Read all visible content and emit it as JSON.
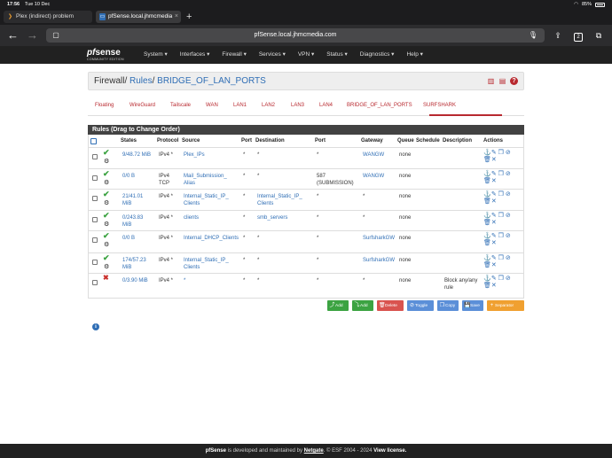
{
  "status_bar": {
    "time": "17:56",
    "date": "Tue 10 Dec",
    "battery": "85%"
  },
  "browser": {
    "tabs": [
      {
        "label": "Plex (indirect) problem"
      },
      {
        "label": "pfSense.local.jhmcmedia"
      }
    ],
    "url": "pfSense.local.jhmcmedia.com",
    "tab_count": "2"
  },
  "pf_nav": {
    "logo": "sense",
    "logo_prefix": "pf",
    "logo_sub": "COMMUNITY EDITION",
    "menu": [
      "System ▾",
      "Interfaces ▾",
      "Firewall ▾",
      "Services ▾",
      "VPN ▾",
      "Status ▾",
      "Diagnostics ▾",
      "Help ▾"
    ]
  },
  "breadcrumb": {
    "root": "Firewall",
    "mid": "Rules",
    "current": "BRIDGE_OF_LAN_PORTS"
  },
  "iface_tabs": [
    "Floating",
    "WireGuard",
    "Tailscale",
    "WAN",
    "LAN1",
    "LAN2",
    "LAN3",
    "LAN4",
    "BRIDGE_OF_LAN_PORTS",
    "SURFSHARK"
  ],
  "panel_title": "Rules (Drag to Change Order)",
  "columns": [
    "States",
    "Protocol",
    "Source",
    "Port",
    "Destination",
    "Port",
    "Gateway",
    "Queue",
    "Schedule",
    "Description",
    "Actions"
  ],
  "rules": [
    {
      "enabled": true,
      "states": "9/48.72 MiB",
      "protocol": "IPv4 *",
      "source": "Plex_IPs",
      "src_port": "*",
      "destination": "*",
      "dst_port": "*",
      "gateway": "WANGW",
      "queue": "none",
      "schedule": "",
      "description": ""
    },
    {
      "enabled": true,
      "states": "0/0 B",
      "protocol": "IPv4\nTCP",
      "source": "Mail_Submission_\nAlias",
      "src_port": "*",
      "destination": "*",
      "dst_port": "587\n(SUBMISSION)",
      "gateway": "WANGW",
      "queue": "none",
      "schedule": "",
      "description": ""
    },
    {
      "enabled": true,
      "states": "21/41.01\nMiB",
      "protocol": "IPv4 *",
      "source": "Internal_Static_IP_\nClients",
      "src_port": "*",
      "destination": "Internal_Static_IP_\nClients",
      "dst_port": "*",
      "gateway": "*",
      "queue": "none",
      "schedule": "",
      "description": ""
    },
    {
      "enabled": true,
      "states": "0/243.83\nMiB",
      "protocol": "IPv4 *",
      "source": "clients",
      "src_port": "*",
      "destination": "smb_servers",
      "dst_port": "*",
      "gateway": "*",
      "queue": "none",
      "schedule": "",
      "description": ""
    },
    {
      "enabled": true,
      "states": "0/0 B",
      "protocol": "IPv4 *",
      "source": "Internal_DHCP_Clients",
      "src_port": "*",
      "destination": "*",
      "dst_port": "*",
      "gateway": "SurfsharkGW",
      "queue": "none",
      "schedule": "",
      "description": ""
    },
    {
      "enabled": true,
      "states": "174/57.23\nMiB",
      "protocol": "IPv4 *",
      "source": "Internal_Static_IP_\nClients",
      "src_port": "*",
      "destination": "*",
      "dst_port": "*",
      "gateway": "SurfsharkGW",
      "queue": "none",
      "schedule": "",
      "description": ""
    },
    {
      "enabled": false,
      "states": "0/3.90 MiB",
      "protocol": "IPv4 *",
      "source": "*",
      "src_port": "*",
      "destination": "*",
      "dst_port": "*",
      "gateway": "*",
      "queue": "none",
      "schedule": "",
      "description": "Block any/any\nrule"
    }
  ],
  "buttons": [
    "Add",
    "Add",
    "Delete",
    "Toggle",
    "Copy",
    "Save",
    "Separator"
  ],
  "footer": {
    "brand": "pfSense",
    "text1": " is developed and maintained by ",
    "company": "Netgate",
    "text2": ". © ESF 2004 - 2024 ",
    "license": "View license."
  }
}
